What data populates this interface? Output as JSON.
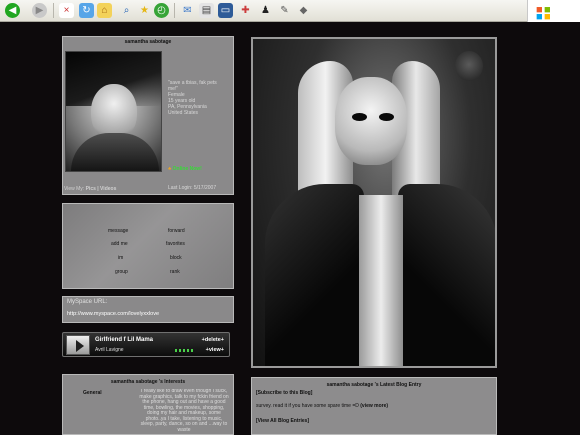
{
  "browser": {
    "toolbar_icons": [
      "back-icon",
      "forward-icon",
      "stop-icon",
      "refresh-icon",
      "home-icon",
      "search-icon",
      "favorites-icon",
      "history-icon",
      "mail-icon",
      "print-icon",
      "edit-icon",
      "tools-icon",
      "aim-icon",
      "messenger-icon",
      "extra-icon"
    ]
  },
  "profile": {
    "title": "samantha sabotage",
    "status_lines": [
      "\"save a tbias, fak pets",
      "me!\"",
      "",
      "Female",
      "15 years old",
      "PA, Pennsylvania",
      "United States"
    ],
    "online": "Online Now!",
    "last_login": "Last Login: 5/17/2007",
    "view_my_prefix": "View My: ",
    "view_my_links": "Pics | Videos"
  },
  "contact": {
    "items": [
      "message",
      "forward",
      "add me",
      "favorites",
      "im",
      "block",
      "group",
      "rank"
    ]
  },
  "url": {
    "label": "MySpace URL:",
    "value": "http://www.myspace.com/lovelyxxlove"
  },
  "music": {
    "song": "Girlfriend f Lil Mama",
    "artist": "Avril Lavigne",
    "delete": "+delete+",
    "view": "+view+"
  },
  "interests": {
    "title": "samantha sabotage 's Interests",
    "label": "General",
    "text": "I really like to draw even though I suck, make graphics, talk to my fckin friend on the phone, hang out and have a good time, bowling, the movies, shopping, doing my hair and makeup, some photo..ya I take, listening to music, sleep, party, dance, so on and ...way to waste"
  },
  "blog": {
    "title": "samantha sabotage 's Latest Blog Entry",
    "subscribe": "[Subscribe to this Blog]",
    "entry": "survey. read it if you have some spare time =D",
    "view_more": "(view more)",
    "view_all": "[View All Blog Entries]"
  },
  "colors": {
    "background": "#0d0a0c",
    "panel": "#8a898a",
    "online": "#38d838",
    "link": "#ffffff"
  }
}
